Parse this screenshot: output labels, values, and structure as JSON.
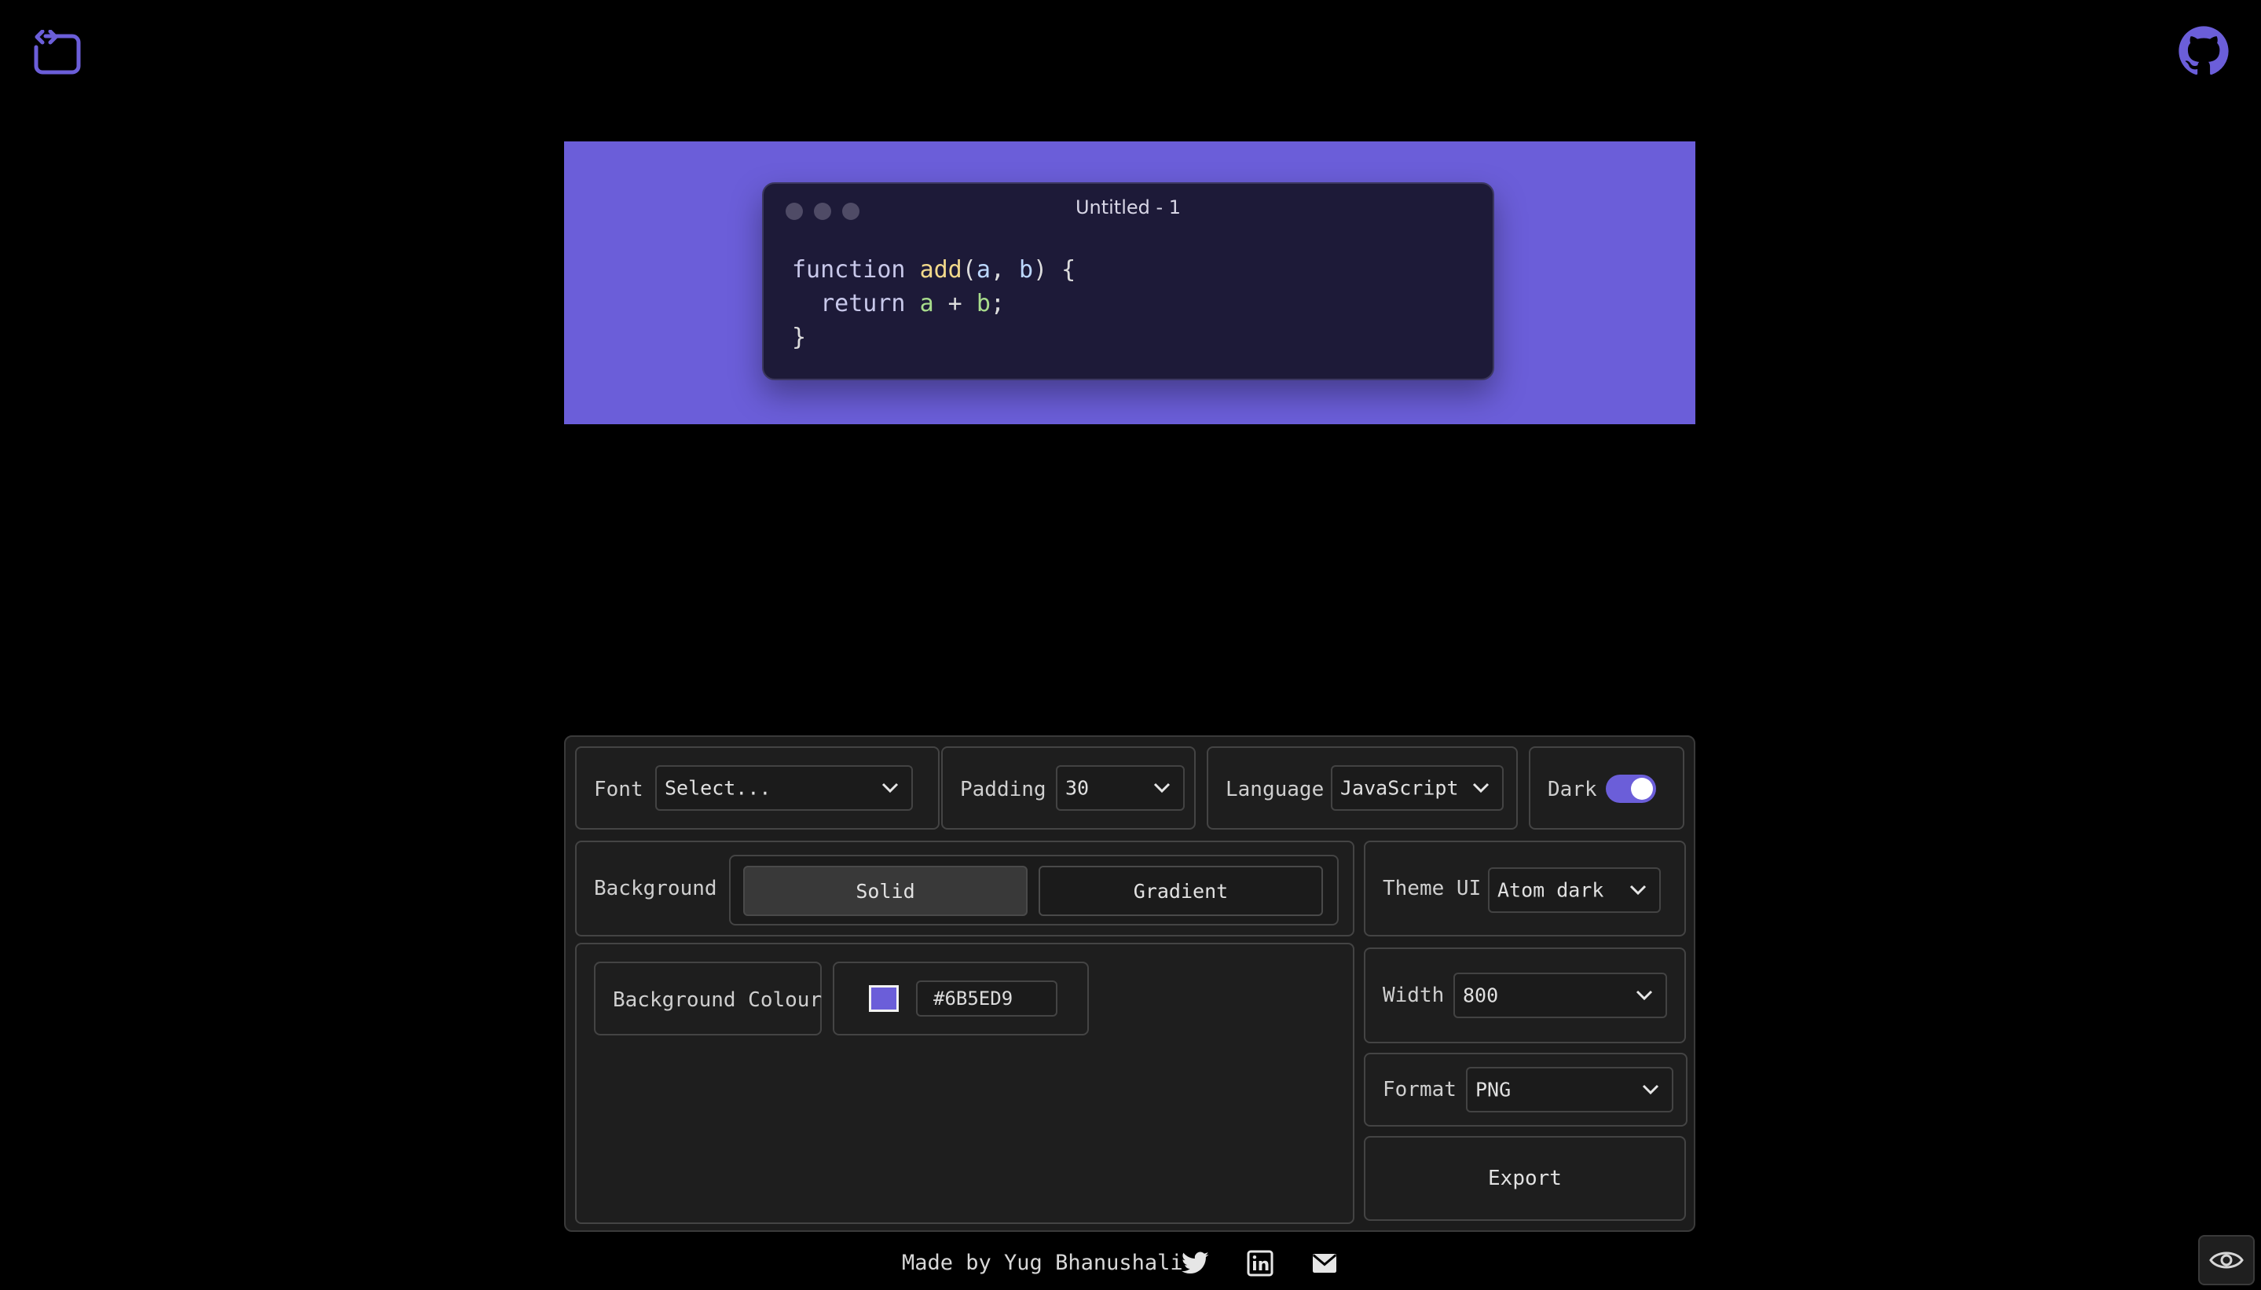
{
  "colors": {
    "accent": "#6B5ED9",
    "background": "#000000"
  },
  "preview": {
    "window_title": "Untitled - 1",
    "code_lines": [
      [
        {
          "t": "function ",
          "c": "kw"
        },
        {
          "t": "add",
          "c": "fn"
        },
        {
          "t": "(",
          "c": ""
        },
        {
          "t": "a",
          "c": "pm"
        },
        {
          "t": ", ",
          "c": ""
        },
        {
          "t": "b",
          "c": "pm"
        },
        {
          "t": ") {",
          "c": ""
        }
      ],
      [
        {
          "t": "  return ",
          "c": "kw"
        },
        {
          "t": "a",
          "c": "nm"
        },
        {
          "t": " + ",
          "c": ""
        },
        {
          "t": "b",
          "c": "nm"
        },
        {
          "t": ";",
          "c": ""
        }
      ],
      [
        {
          "t": "}",
          "c": ""
        }
      ]
    ]
  },
  "controls": {
    "font": {
      "label": "Font",
      "value": "Select..."
    },
    "padding": {
      "label": "Padding",
      "value": "30"
    },
    "language": {
      "label": "Language",
      "value": "JavaScript"
    },
    "dark": {
      "label": "Dark",
      "on": true
    },
    "background": {
      "label": "Background",
      "options": [
        "Solid",
        "Gradient"
      ],
      "selected": "Solid"
    },
    "theme_ui": {
      "label": "Theme UI",
      "value": "Atom dark"
    },
    "background_colour": {
      "label": "Background Colour",
      "hex": "#6B5ED9"
    },
    "width": {
      "label": "Width",
      "value": "800"
    },
    "format": {
      "label": "Format",
      "value": "PNG"
    },
    "export_label": "Export"
  },
  "footer": {
    "made_by": "Made by Yug Bhanushali",
    "icons": [
      "twitter-icon",
      "linkedin-icon",
      "mail-icon"
    ]
  }
}
